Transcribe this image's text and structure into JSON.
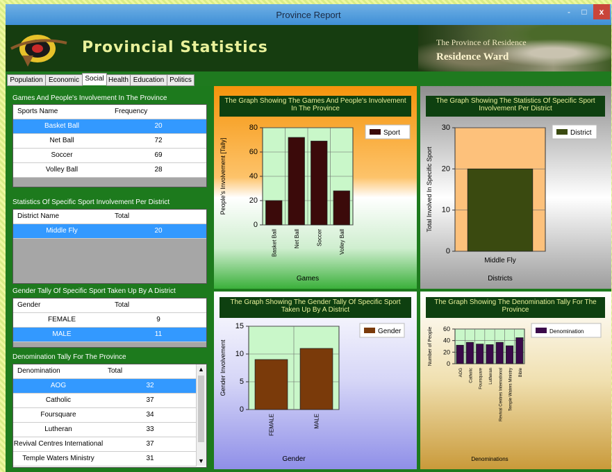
{
  "window": {
    "title": "Province Report",
    "min_label": "-",
    "max_label": "□",
    "close_label": "x"
  },
  "banner": {
    "app_title": "Provincial Statistics",
    "line1": "The Province of Residence",
    "line2": "Residence Ward"
  },
  "tabs": [
    "Population",
    "Economic",
    "Social",
    "Health",
    "Education",
    "Politics"
  ],
  "active_tab": "Social",
  "sports": {
    "title": "Games And People's Involvement In The Province",
    "columns": [
      "Sports Name",
      "Frequency"
    ],
    "rows": [
      [
        "Basket Ball",
        "20"
      ],
      [
        "Net Ball",
        "72"
      ],
      [
        "Soccer",
        "69"
      ],
      [
        "Volley Ball",
        "28"
      ]
    ]
  },
  "district": {
    "title": "Statistics Of Specific Sport Involvement Per District",
    "columns": [
      "District Name",
      "Total"
    ],
    "rows": [
      [
        "Middle Fly",
        "20"
      ]
    ]
  },
  "gender": {
    "title": "Gender Tally Of Specific Sport Taken Up By A District",
    "columns": [
      "Gender",
      "Total"
    ],
    "rows": [
      [
        "FEMALE",
        "9"
      ],
      [
        "MALE",
        "11"
      ]
    ]
  },
  "denomination": {
    "title": "Denomination Tally For The Province",
    "columns": [
      "Denomination",
      "Total"
    ],
    "rows": [
      [
        "AOG",
        "32"
      ],
      [
        "Catholic",
        "37"
      ],
      [
        "Foursquare",
        "34"
      ],
      [
        "Lutheran",
        "33"
      ],
      [
        "Revival Centres International",
        "37"
      ],
      [
        "Temple Waters Ministry",
        "31"
      ]
    ]
  },
  "chart_data": [
    {
      "type": "bar",
      "title": "The Graph Showing The Games And People's Involvement In The Province",
      "categories": [
        "Basket Ball",
        "Net Ball",
        "Soccer",
        "Volley Ball"
      ],
      "series": [
        {
          "name": "Sport",
          "values": [
            20,
            72,
            69,
            28
          ]
        }
      ],
      "xlabel": "Games",
      "ylabel": "People's Involvement [Tally]",
      "ylim": [
        0,
        80
      ],
      "yticks": [
        0,
        20,
        40,
        60,
        80
      ],
      "color": "#3b0a0a",
      "legend": "top-right",
      "grid": true
    },
    {
      "type": "bar",
      "title": "The Graph Showing The Statistics Of Specific Sport Involvement Per District",
      "categories": [
        "Middle Fly"
      ],
      "series": [
        {
          "name": "District",
          "values": [
            20
          ]
        }
      ],
      "xlabel": "Districts",
      "ylabel": "Total Involved In Specific Sport",
      "ylim": [
        0,
        30
      ],
      "yticks": [
        0,
        10,
        20,
        30
      ],
      "color": "#3a4a10",
      "legend": "top-right",
      "grid": true
    },
    {
      "type": "bar",
      "title": "The Graph Showing The Gender Tally Of Specific Sport Taken Up By A District",
      "categories": [
        "FEMALE",
        "MALE"
      ],
      "series": [
        {
          "name": "Gender",
          "values": [
            9,
            11
          ]
        }
      ],
      "xlabel": "Gender",
      "ylabel": "Gender Involvement",
      "ylim": [
        0,
        15
      ],
      "yticks": [
        0,
        5,
        10,
        15
      ],
      "color": "#7a3a0a",
      "legend": "top-right",
      "grid": true
    },
    {
      "type": "bar",
      "title": "The Graph Showing The Denomination Tally For The Province",
      "categories": [
        "AOG",
        "Catholic",
        "Foursquare",
        "Lutheran",
        "Revival Centres International",
        "Temple Waters Ministry",
        "Bible"
      ],
      "series": [
        {
          "name": "Denomination",
          "values": [
            32,
            37,
            34,
            33,
            37,
            31,
            45
          ]
        }
      ],
      "xlabel": "Denominations",
      "ylabel": "Number of People",
      "ylim": [
        0,
        60
      ],
      "yticks": [
        0,
        20,
        40,
        60
      ],
      "color": "#3a0a4a",
      "legend": "top-right",
      "grid": true
    }
  ]
}
